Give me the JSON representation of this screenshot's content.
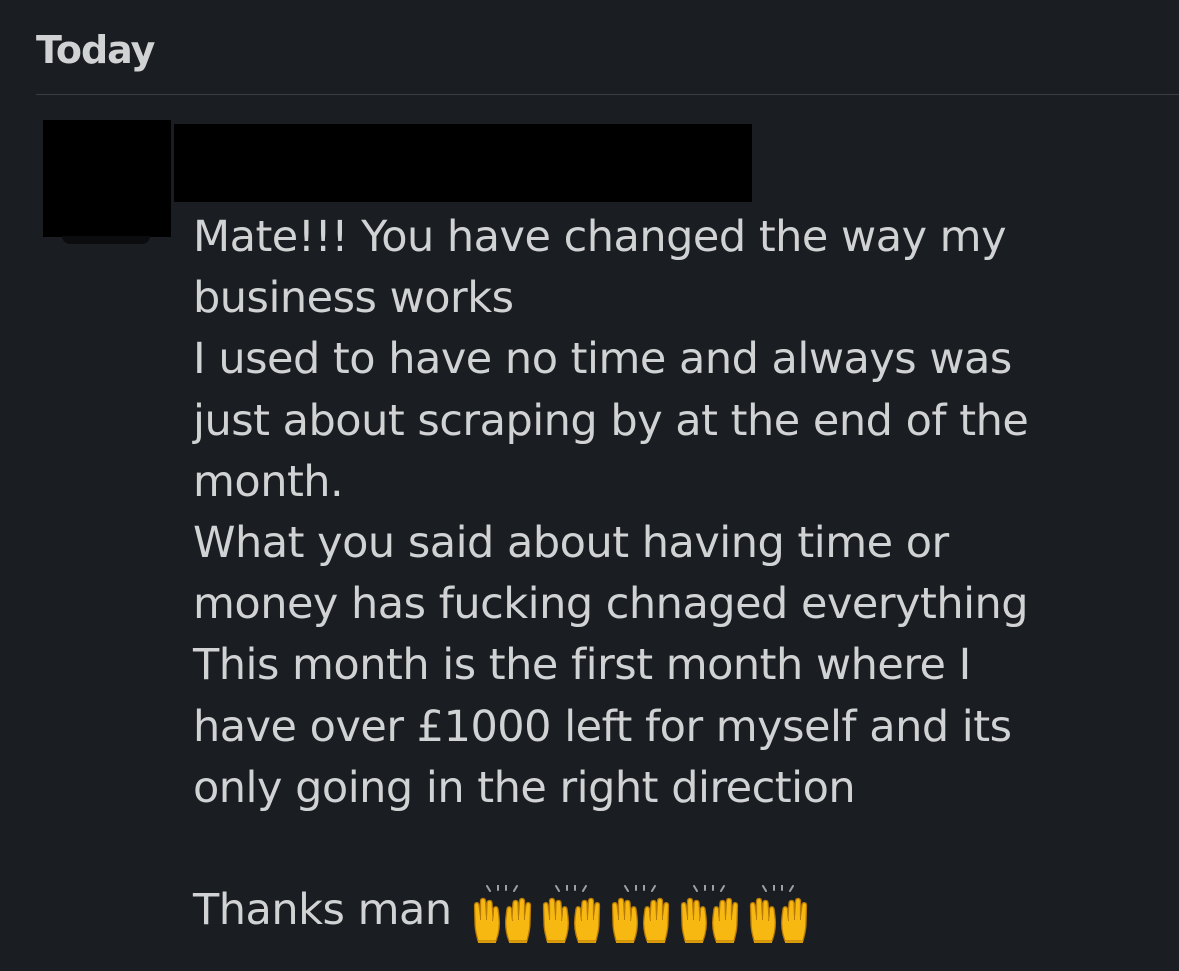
{
  "day_header": "Today",
  "sender": {
    "avatar": "redacted-avatar",
    "name": ""
  },
  "message": {
    "lines": [
      "Mate!!! You have changed the way my",
      "business works",
      "I used to have no time and always was",
      "just about scraping by at the end of the",
      "month.",
      "What you said about having time or",
      "money has fucking chnaged everything",
      "This month is the first month where I",
      "have over £1000 left for myself and its",
      "only going in the right direction"
    ],
    "closing": "Thanks man",
    "emoji": [
      "raising-hands",
      "raising-hands",
      "raising-hands",
      "raising-hands",
      "raising-hands"
    ]
  },
  "colors": {
    "background": "#1a1d21",
    "text": "#d1d2d3",
    "divider": "#3a3d42",
    "emoji_yellow": "#f7b911"
  }
}
